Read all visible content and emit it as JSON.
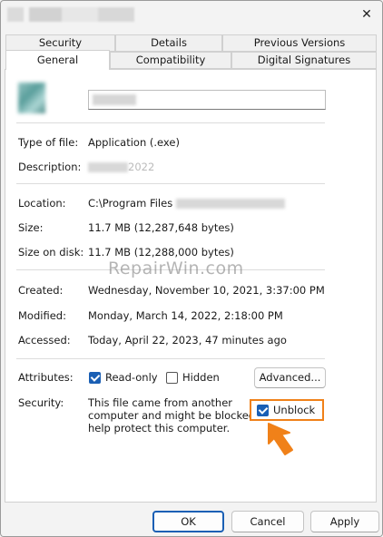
{
  "window": {
    "close_glyph": "✕"
  },
  "tabs": {
    "row1": [
      "Security",
      "Details",
      "Previous Versions"
    ],
    "row2": [
      "General",
      "Compatibility",
      "Digital Signatures"
    ],
    "active": "General"
  },
  "general": {
    "type_label": "Type of file:",
    "type_value": "Application (.exe)",
    "description_label": "Description:",
    "description_value": "2022",
    "location_label": "Location:",
    "location_value": "C:\\Program Files",
    "size_label": "Size:",
    "size_value": "11.7 MB (12,287,648 bytes)",
    "size_on_disk_label": "Size on disk:",
    "size_on_disk_value": "11.7 MB (12,288,000 bytes)",
    "created_label": "Created:",
    "created_value": "Wednesday, November 10, 2021, 3:37:00 PM",
    "modified_label": "Modified:",
    "modified_value": "Monday, March 14, 2022, 2:18:00 PM",
    "accessed_label": "Accessed:",
    "accessed_value": "Today, April 22, 2023, 47 minutes ago",
    "attributes_label": "Attributes:",
    "readonly_label": "Read-only",
    "readonly_checked": true,
    "hidden_label": "Hidden",
    "hidden_checked": false,
    "advanced_button": "Advanced...",
    "security_label": "Security:",
    "security_line1": "This file came from another",
    "security_line2": "computer and might be blocked to",
    "security_line3": "help protect this computer.",
    "unblock_label": "Unblock",
    "unblock_checked": true
  },
  "watermark": "RepairWin.com",
  "footer": {
    "ok": "OK",
    "cancel": "Cancel",
    "apply": "Apply"
  },
  "colors": {
    "accent": "#1a5fb4",
    "highlight": "#f08119"
  }
}
